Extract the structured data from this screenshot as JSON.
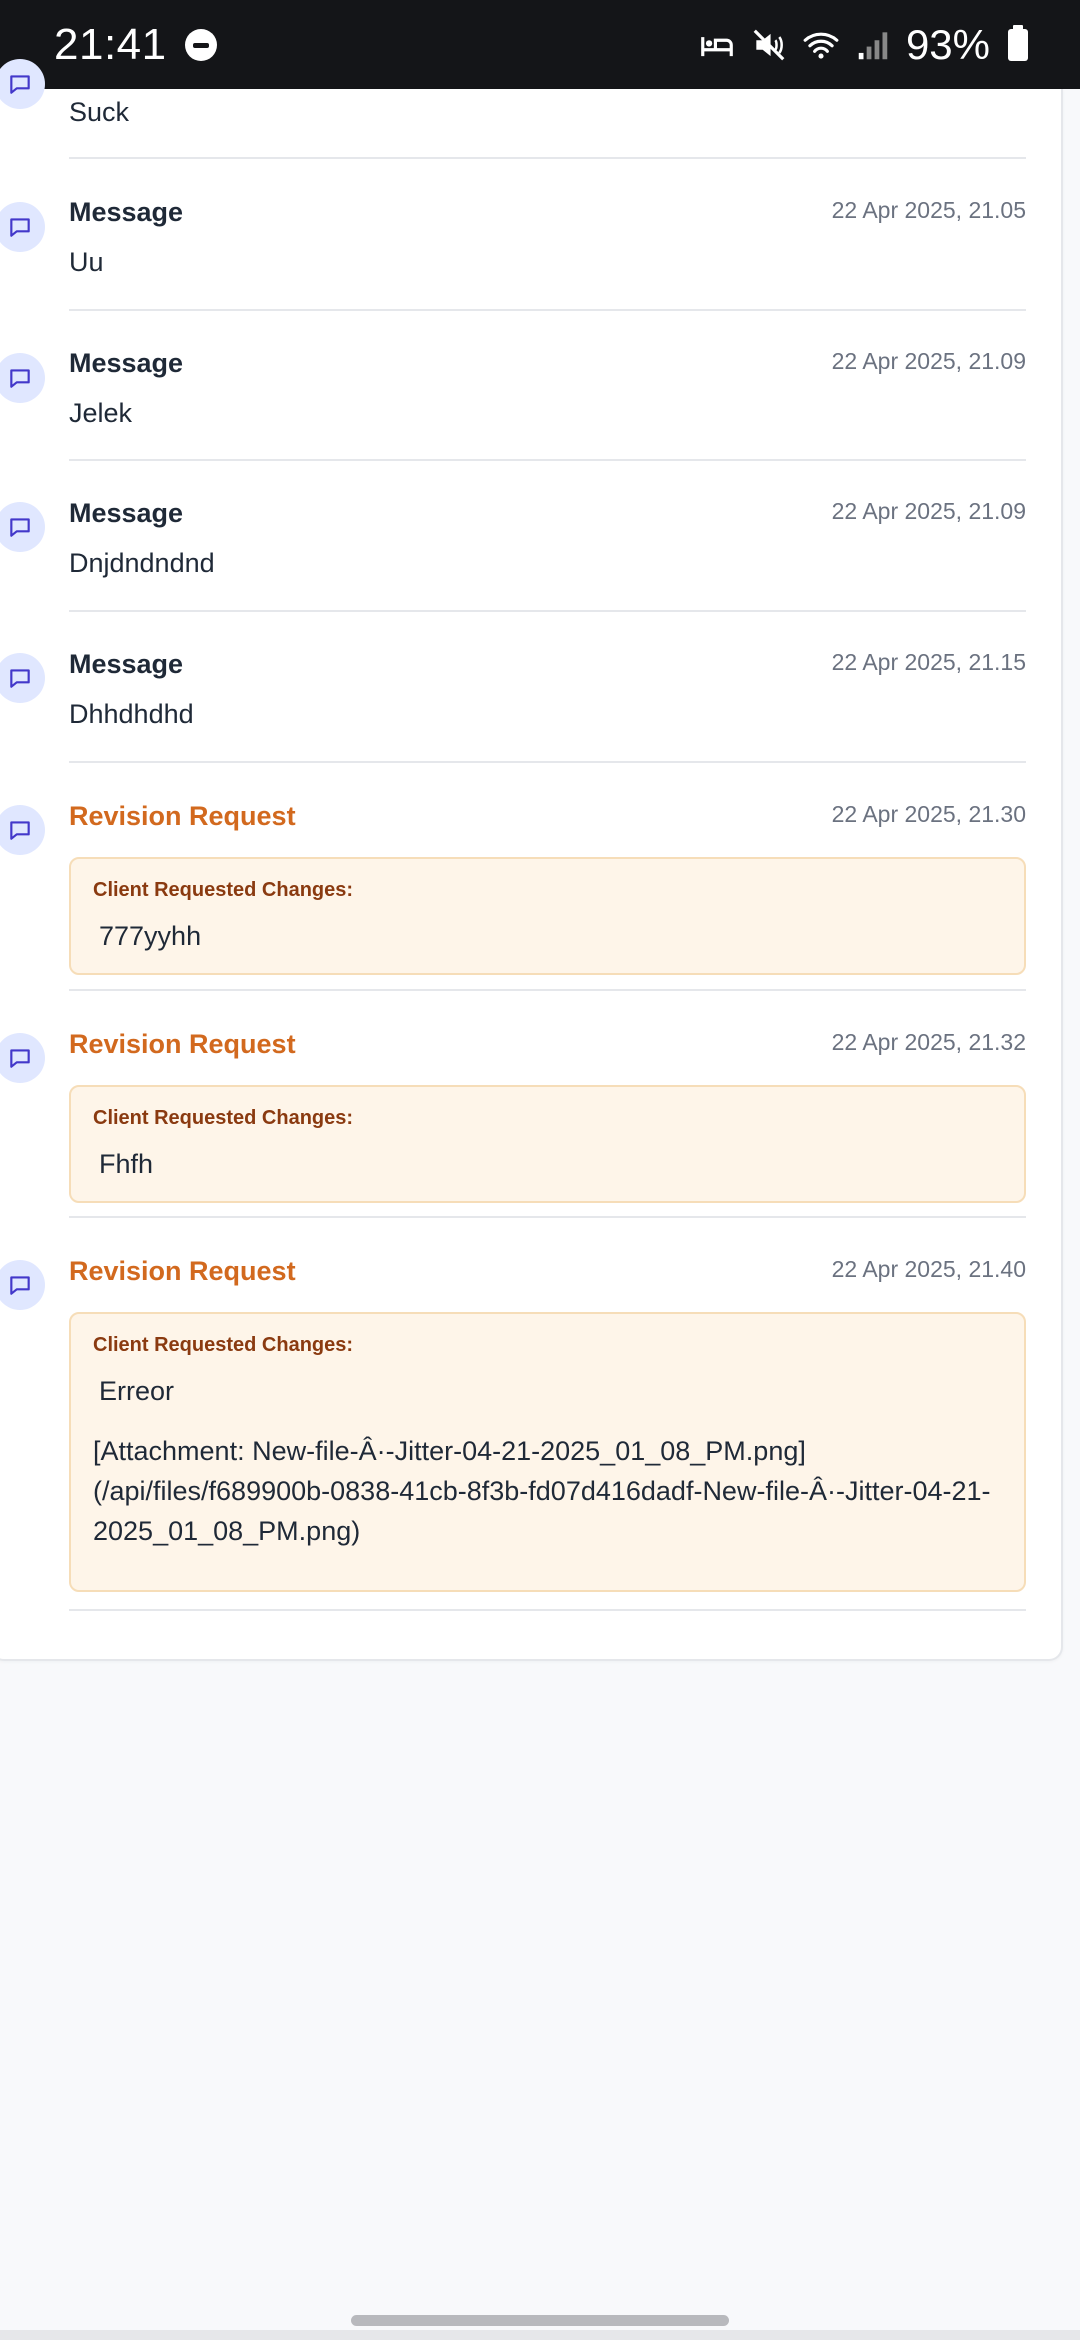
{
  "status_bar": {
    "time": "21:41",
    "battery_percent": "93%",
    "icons": [
      "do-not-disturb-icon",
      "sleep-mode-icon",
      "mute-icon",
      "wifi-icon",
      "signal-icon",
      "battery-icon"
    ]
  },
  "colors": {
    "accent_revision": "#d2691e",
    "icon_bg": "#e0e7ff",
    "icon_stroke": "#4338ca",
    "change_box_bg": "#fef5e9"
  },
  "entries": [
    {
      "type": "message",
      "title": "",
      "time": "",
      "body": "Suck"
    },
    {
      "type": "message",
      "title": "Message",
      "time": "22 Apr 2025, 21.05",
      "body": "Uu"
    },
    {
      "type": "message",
      "title": "Message",
      "time": "22 Apr 2025, 21.09",
      "body": "Jelek"
    },
    {
      "type": "message",
      "title": "Message",
      "time": "22 Apr 2025, 21.09",
      "body": "Dnjdndndnd"
    },
    {
      "type": "message",
      "title": "Message",
      "time": "22 Apr 2025, 21.15",
      "body": "Dhhdhdhd"
    },
    {
      "type": "revision",
      "title": "Revision Request",
      "time": "22 Apr 2025, 21.30",
      "label": "Client Requested Changes:",
      "body": "777yyhh"
    },
    {
      "type": "revision",
      "title": "Revision Request",
      "time": "22 Apr 2025, 21.32",
      "label": "Client Requested Changes:",
      "body": "Fhfh"
    },
    {
      "type": "revision",
      "title": "Revision Request",
      "time": "22 Apr 2025, 21.40",
      "label": "Client Requested Changes:",
      "body": "Erreor",
      "attachment": "[Attachment: New-file-Â·-Jitter-04-21-2025_01_08_PM.png](/api/files/f689900b-0838-41cb-8f3b-fd07d416dadf-New-file-Â·-Jitter-04-21-2025_01_08_PM.png)"
    }
  ]
}
